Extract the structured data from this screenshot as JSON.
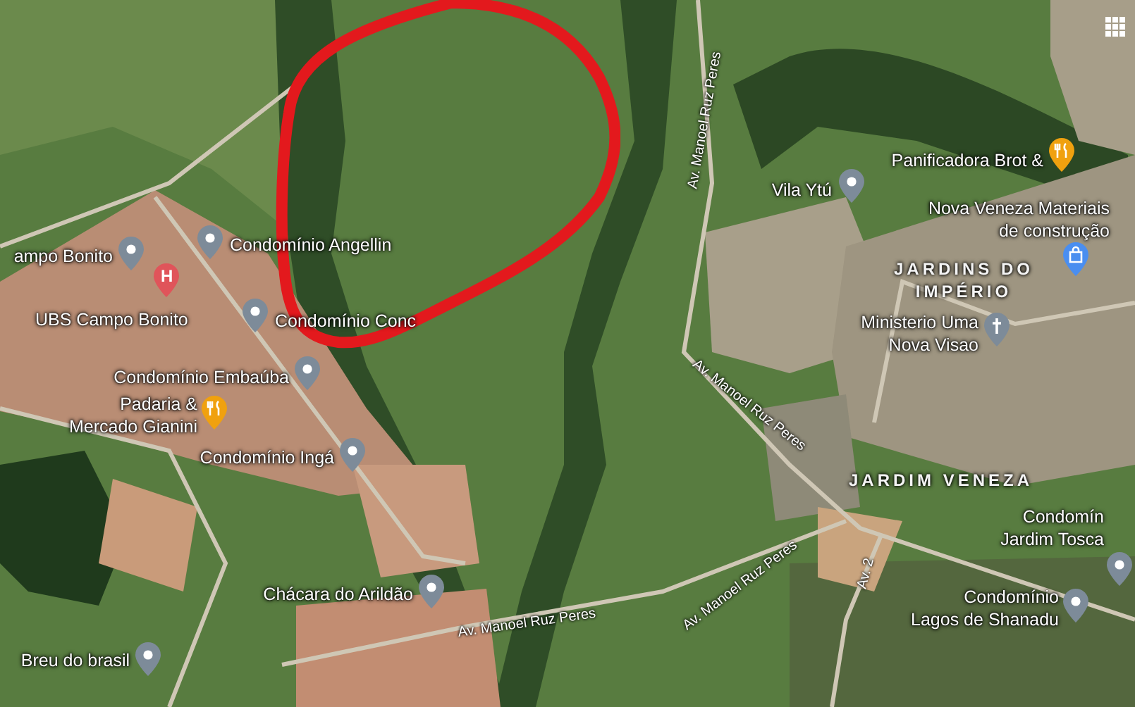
{
  "map": {
    "places": [
      {
        "kind": "place",
        "lines": [
          "ampo Bonito"
        ]
      },
      {
        "kind": "place",
        "lines": [
          "Condomínio Angellin"
        ]
      },
      {
        "kind": "hospital",
        "glyph": "H",
        "lines": [
          "UBS Campo Bonito"
        ]
      },
      {
        "kind": "place",
        "lines": [
          "Condomínio Conc"
        ]
      },
      {
        "kind": "place",
        "lines": [
          "Condomínio Embaúba"
        ]
      },
      {
        "kind": "food",
        "lines": [
          "Padaria &",
          "Mercado Gianini"
        ]
      },
      {
        "kind": "place",
        "lines": [
          "Condomínio Ingá"
        ]
      },
      {
        "kind": "place",
        "lines": [
          "Chácara do Arildão"
        ]
      },
      {
        "kind": "place",
        "lines": [
          "Breu do brasil"
        ]
      },
      {
        "kind": "place",
        "lines": [
          "Vila Ytú"
        ]
      },
      {
        "kind": "food",
        "lines": [
          "Panificadora Brot &"
        ]
      },
      {
        "kind": "shopping",
        "lines": [
          "Nova Veneza Materiais",
          "de construção"
        ]
      },
      {
        "kind": "church",
        "lines": [
          "Ministerio Uma",
          "Nova Visao"
        ]
      },
      {
        "kind": "place",
        "lines": [
          "Condomín",
          "Jardim Tosca"
        ]
      },
      {
        "kind": "place",
        "lines": [
          "Condomínio",
          "Lagos de Shanadu"
        ]
      }
    ],
    "districts": [
      {
        "lines": [
          "JARDINS DO",
          "IMPÉRIO"
        ]
      },
      {
        "lines": [
          "JARDIM VENEZA"
        ]
      }
    ],
    "roads": [
      "Av. Manoel Ruz Peres",
      "Av. Manoel Ruz Peres",
      "Av. Manoel Ruz Peres",
      "Av. Manoel Ruz Peres",
      "Av. 2"
    ]
  }
}
